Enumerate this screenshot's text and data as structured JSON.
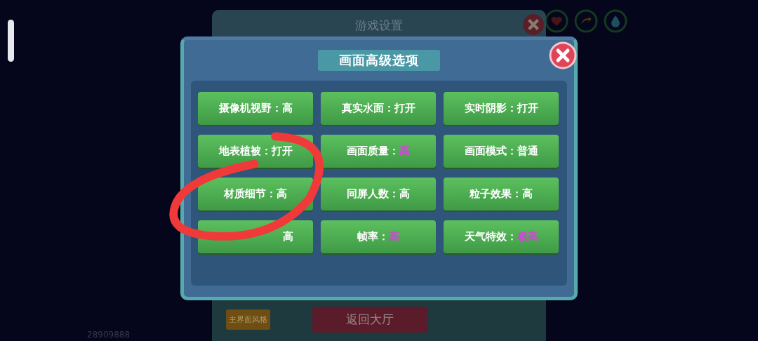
{
  "background_window": {
    "title": "游戏设置",
    "buttons": [
      {
        "label": "主界面风格",
        "kind": "style"
      },
      {
        "label": "返回大厅",
        "kind": "lobby"
      }
    ]
  },
  "player_id": "28909888",
  "dialog": {
    "title": "画面高级选项",
    "options": [
      {
        "label": "摄像机视野：",
        "value": "高",
        "highlight": false
      },
      {
        "label": "真实水面：",
        "value": "打开",
        "highlight": false
      },
      {
        "label": "实时阴影：",
        "value": "打开",
        "highlight": false
      },
      {
        "label": "地表植被：",
        "value": "打开",
        "highlight": false
      },
      {
        "label": "画面质量：",
        "value": "高",
        "highlight": true
      },
      {
        "label": "画面模式：",
        "value": "普通",
        "highlight": false
      },
      {
        "label": "材质细节：",
        "value": "高",
        "highlight": false
      },
      {
        "label": "同屏人数：",
        "value": "高",
        "highlight": false
      },
      {
        "label": "粒子效果：",
        "value": "高",
        "highlight": false
      },
      {
        "value": "高",
        "highlight": false
      },
      {
        "label": "帧率：",
        "value": "高",
        "highlight": true
      },
      {
        "label": "天气特效：",
        "value": "极高",
        "highlight": true
      }
    ]
  }
}
